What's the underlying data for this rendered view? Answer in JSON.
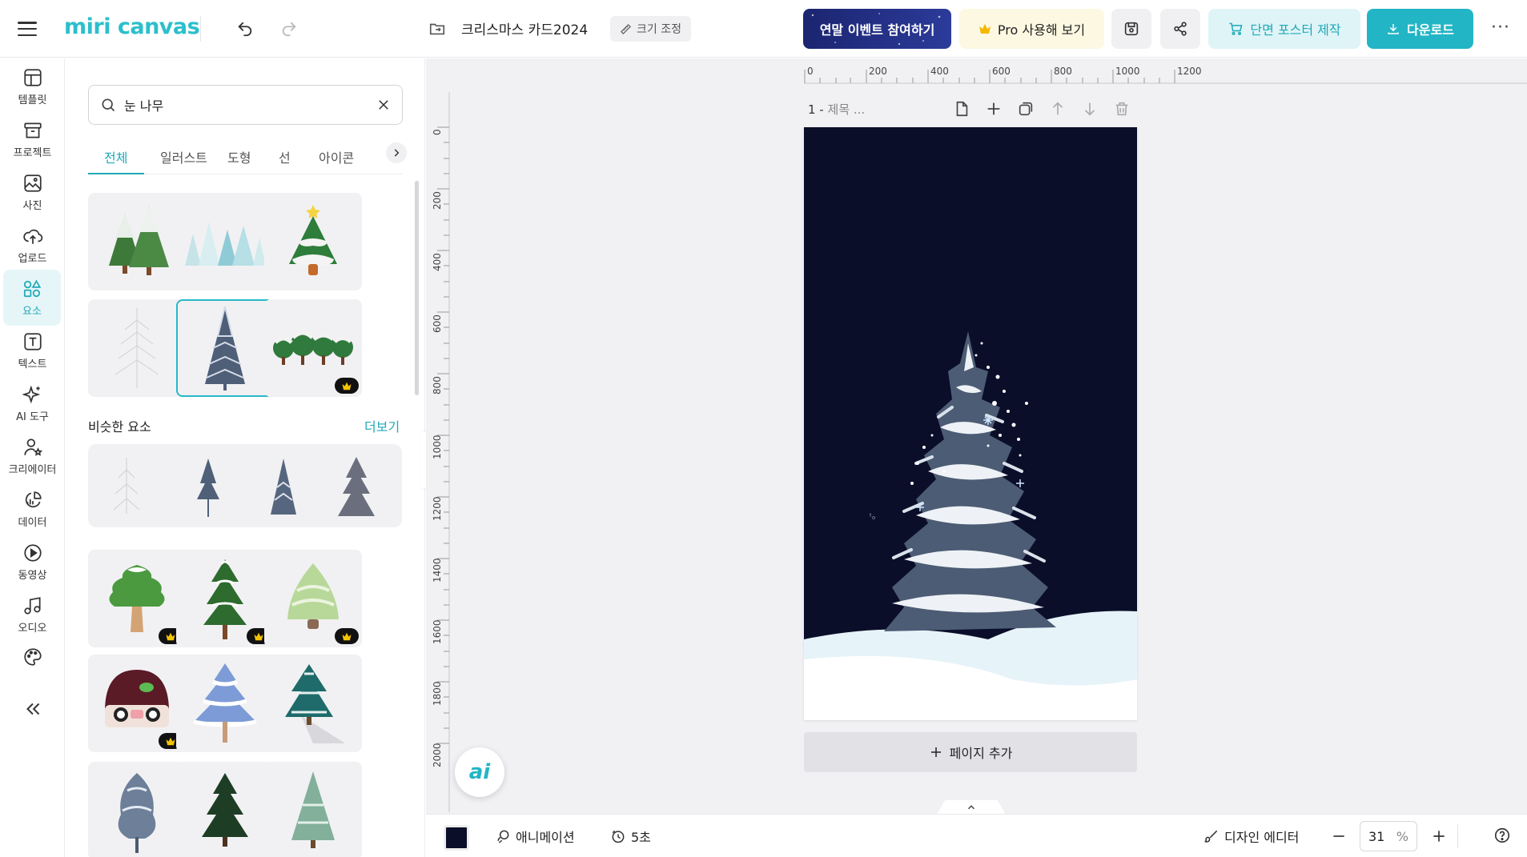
{
  "topbar": {
    "logo": "miri canvas",
    "doc_title": "크리스마스 카드2024",
    "resize_label": "크기 조정",
    "event_button": "연말 이벤트 참여하기",
    "pro_button": "Pro 사용해 보기",
    "poster_button": "단면 포스터 제작",
    "download_button": "다운로드",
    "more": "···"
  },
  "leftnav": {
    "items": [
      {
        "label": "템플릿",
        "icon": "template-icon"
      },
      {
        "label": "프로젝트",
        "icon": "archive-icon"
      },
      {
        "label": "사진",
        "icon": "image-icon"
      },
      {
        "label": "업로드",
        "icon": "upload-cloud-icon"
      },
      {
        "label": "요소",
        "icon": "shapes-icon",
        "active": true
      },
      {
        "label": "텍스트",
        "icon": "text-icon"
      },
      {
        "label": "AI 도구",
        "icon": "sparkle-icon"
      },
      {
        "label": "크리에이터",
        "icon": "creator-icon"
      },
      {
        "label": "데이터",
        "icon": "chart-icon"
      },
      {
        "label": "동영상",
        "icon": "play-icon"
      },
      {
        "label": "오디오",
        "icon": "music-icon"
      }
    ],
    "palette_icon": "palette-icon",
    "collapse_icon": "double-chevron-left-icon"
  },
  "panel": {
    "search_value": "눈 나무",
    "tabs": [
      "전체",
      "일러스트",
      "도형",
      "선",
      "아이콘"
    ],
    "active_tab": "전체",
    "similar_title": "비슷한 요소",
    "more_link": "더보기"
  },
  "canvas": {
    "page_number": "1 -",
    "page_title_placeholder": "제목 ...",
    "add_page": "페이지 추가",
    "ruler_h": [
      "0",
      "200",
      "400",
      "600",
      "800",
      "1000",
      "1200"
    ],
    "ruler_v": [
      "0",
      "200",
      "400",
      "600",
      "800",
      "1000",
      "1200",
      "1400",
      "1600",
      "1800",
      "2000"
    ],
    "background_color": "#0b0e29",
    "ai_label": "ai"
  },
  "bottombar": {
    "animation": "애니메이션",
    "duration": "5초",
    "design_editor": "디자인 에디터",
    "zoom": "31",
    "zoom_unit": "%"
  },
  "colors": {
    "accent": "#22b5c5",
    "event_bg": "#1b2570",
    "pro_bg": "#fdf8e2",
    "page_bg": "#0b0e29"
  }
}
